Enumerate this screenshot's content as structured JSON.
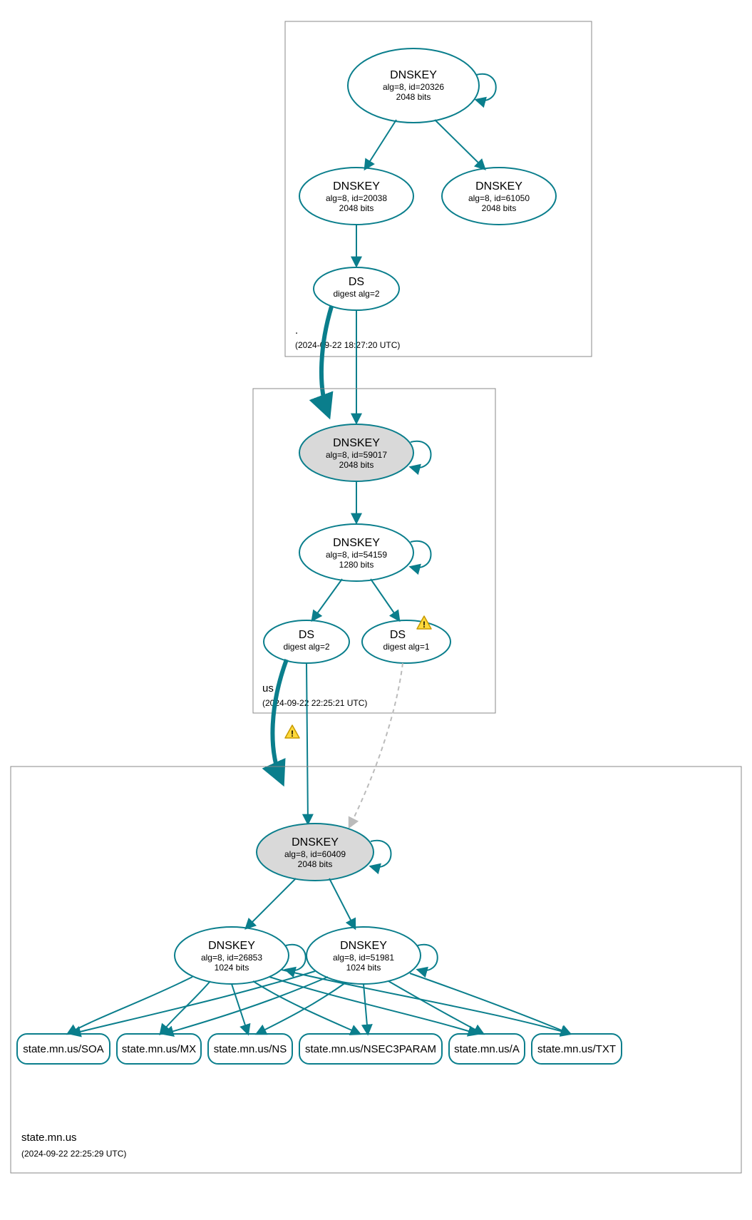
{
  "colors": {
    "stroke": "#0a7e8c",
    "box": "#888888",
    "fillKSK": "#d9d9d9",
    "warn": "#ffd93b"
  },
  "zones": {
    "root": {
      "label": ".",
      "timestamp": "(2024-09-22 18:27:20 UTC)",
      "nodes": {
        "ksk": {
          "title": "DNSKEY",
          "line2": "alg=8, id=20326",
          "line3": "2048 bits"
        },
        "zsk1": {
          "title": "DNSKEY",
          "line2": "alg=8, id=20038",
          "line3": "2048 bits"
        },
        "zsk2": {
          "title": "DNSKEY",
          "line2": "alg=8, id=61050",
          "line3": "2048 bits"
        },
        "ds": {
          "title": "DS",
          "line2": "digest alg=2"
        }
      }
    },
    "us": {
      "label": "us",
      "timestamp": "(2024-09-22 22:25:21 UTC)",
      "nodes": {
        "ksk": {
          "title": "DNSKEY",
          "line2": "alg=8, id=59017",
          "line3": "2048 bits"
        },
        "zsk": {
          "title": "DNSKEY",
          "line2": "alg=8, id=54159",
          "line3": "1280 bits"
        },
        "ds1": {
          "title": "DS",
          "line2": "digest alg=2"
        },
        "ds2": {
          "title": "DS",
          "line2": "digest alg=1",
          "warn": true
        }
      }
    },
    "state": {
      "label": "state.mn.us",
      "timestamp": "(2024-09-22 22:25:29 UTC)",
      "nodes": {
        "ksk": {
          "title": "DNSKEY",
          "line2": "alg=8, id=60409",
          "line3": "2048 bits"
        },
        "zsk1": {
          "title": "DNSKEY",
          "line2": "alg=8, id=26853",
          "line3": "1024 bits"
        },
        "zsk2": {
          "title": "DNSKEY",
          "line2": "alg=8, id=51981",
          "line3": "1024 bits"
        }
      },
      "rrsets": {
        "soa": "state.mn.us/SOA",
        "mx": "state.mn.us/MX",
        "ns": "state.mn.us/NS",
        "n3p": "state.mn.us/NSEC3PARAM",
        "a": "state.mn.us/A",
        "txt": "state.mn.us/TXT"
      }
    }
  },
  "interzone_warn": true
}
